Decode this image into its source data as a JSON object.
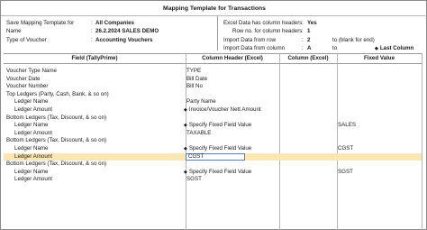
{
  "title": "Mapping Template for Transactions",
  "info_left": [
    {
      "label": "Save Mapping Template for",
      "value": "All Companies"
    },
    {
      "label": "Name",
      "value": "26.2.2024 SALES DEMO"
    },
    {
      "label": "Type of Voucher",
      "value": "Accounting Vouchers"
    }
  ],
  "info_right": {
    "excel_has_headers_label": "Excel Data has column headers",
    "excel_has_headers_value": "Yes",
    "row_no_label": "Row no. for column headers",
    "row_no_value": "1",
    "import_row_label": "Import Data from row",
    "import_row_value": "2",
    "import_row_to": "to  (blank for end)",
    "import_col_label": "Import Data from column",
    "import_col_value": "A",
    "import_col_to": "to",
    "import_col_end": "Last Column"
  },
  "columns": [
    "Field (TallyPrime)",
    "Column Header (Excel)",
    "Column (Excel)",
    "Fixed Value"
  ],
  "rows": [
    {
      "field": "Voucher Type Name",
      "indent": false,
      "column_header": "TYPE",
      "fixed_value": ""
    },
    {
      "field": "Voucher Date",
      "indent": false,
      "column_header": "Bill Date",
      "fixed_value": ""
    },
    {
      "field": "Voucher Number",
      "indent": false,
      "column_header": "Bill No",
      "fixed_value": ""
    },
    {
      "field": "Top Ledgers (Party, Cash, Bank, & so on)",
      "indent": false,
      "column_header": "",
      "fixed_value": ""
    },
    {
      "field": "Ledger Name",
      "indent": true,
      "column_header": "Party Name",
      "fixed_value": ""
    },
    {
      "field": "Ledger Amount",
      "indent": true,
      "column_header": "Invoice/Voucher Nett Amount",
      "fixed_value": "",
      "diamond": true
    },
    {
      "field": "Bottom Ledgers (Tax, Discount, & so on)",
      "indent": false,
      "column_header": "",
      "fixed_value": ""
    },
    {
      "field": "Ledger Name",
      "indent": true,
      "column_header": "Specify Fixed Field Value",
      "fixed_value": "SALES",
      "diamond": true
    },
    {
      "field": "Ledger Amount",
      "indent": true,
      "column_header": "TAXABLE",
      "fixed_value": ""
    },
    {
      "field": "Bottom Ledgers (Tax, Discount, & so on)",
      "indent": false,
      "column_header": "",
      "fixed_value": ""
    },
    {
      "field": "Ledger Name",
      "indent": true,
      "column_header": "Specify Fixed Field Value",
      "fixed_value": "CGST",
      "diamond": true
    },
    {
      "field": "Ledger Amount",
      "indent": true,
      "column_header": "CGST",
      "fixed_value": "",
      "active": true
    },
    {
      "field": "Bottom Ledgers (Tax, Discount, & so on)",
      "indent": false,
      "column_header": "",
      "fixed_value": ""
    },
    {
      "field": "Ledger Name",
      "indent": true,
      "column_header": "Specify Fixed Field Value",
      "fixed_value": "SGST",
      "diamond": true
    },
    {
      "field": "Ledger Amount",
      "indent": true,
      "column_header": "SGST",
      "fixed_value": ""
    }
  ]
}
